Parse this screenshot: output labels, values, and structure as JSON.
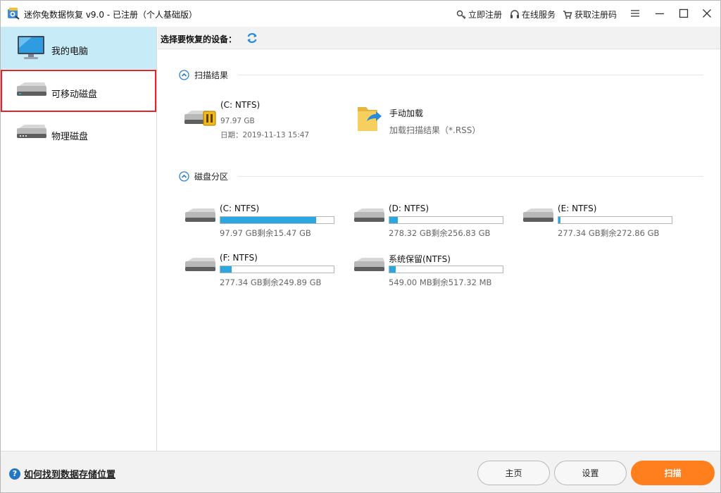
{
  "window": {
    "title": "迷你兔数据恢复 v9.0 - 已注册（个人基础版）",
    "links": {
      "register": "立即注册",
      "online_service": "在线服务",
      "get_code": "获取注册码"
    },
    "icons": [
      "key-icon",
      "headset-icon",
      "cart-icon",
      "menu-icon",
      "minimize-icon",
      "maximize-icon",
      "close-icon"
    ]
  },
  "sidebar": {
    "items": [
      {
        "label": "我的电脑",
        "icon": "monitor-icon",
        "state": "active"
      },
      {
        "label": "可移动磁盘",
        "icon": "removable-disk-icon",
        "state": "selected"
      },
      {
        "label": "物理磁盘",
        "icon": "physical-disk-icon",
        "state": "normal"
      }
    ]
  },
  "main": {
    "device_label": "选择要恢复的设备：",
    "scan_results": {
      "title": "扫描结果",
      "items": [
        {
          "name": "(C: NTFS)",
          "size": "97.97 GB",
          "date": "日期：2019-11-13 15:47",
          "icon": "drive-paused-icon"
        },
        {
          "name": "手动加载",
          "sub": "加载扫描结果（*.RSS）",
          "icon": "folder-load-icon"
        }
      ]
    },
    "partitions": {
      "title": "磁盘分区",
      "items": [
        {
          "name": "(C: NTFS)",
          "info": "97.97 GB剩余15.47 GB",
          "used_fraction": 0.842
        },
        {
          "name": "(D: NTFS)",
          "info": "278.32 GB剩余256.83 GB",
          "used_fraction": 0.077
        },
        {
          "name": "(E: NTFS)",
          "info": "277.34 GB剩余272.86 GB",
          "used_fraction": 0.016
        },
        {
          "name": "(F: NTFS)",
          "info": "277.34 GB剩余249.89 GB",
          "used_fraction": 0.099
        },
        {
          "name": "系统保留(NTFS)",
          "info": "549.00 MB剩余517.32 MB",
          "used_fraction": 0.058
        }
      ]
    }
  },
  "footer": {
    "help_text": "如何找到数据存储位置",
    "buttons": {
      "home": "主页",
      "settings": "设置",
      "scan": "扫描"
    }
  },
  "colors": {
    "accent_orange": "#ff7f1e",
    "bar_blue": "#2aa7e0",
    "active_bg": "#c8ebf8",
    "selected_outline": "#e0262b"
  }
}
